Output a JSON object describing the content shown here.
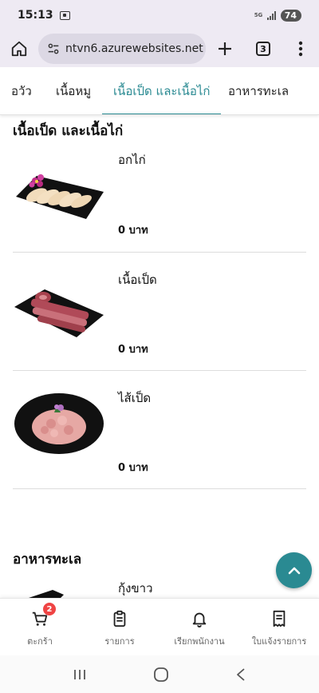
{
  "status_bar": {
    "time": "15:13",
    "network": "5G",
    "battery": "74"
  },
  "browser": {
    "url": "ntvn6.azurewebsites.net",
    "tab_count": "3"
  },
  "category_tabs": [
    {
      "label": "อวัว"
    },
    {
      "label": "เนื้อหมู"
    },
    {
      "label": "เนื้อเป็ด และเนื้อไก่"
    },
    {
      "label": "อาหารทะเล"
    }
  ],
  "sections": [
    {
      "title": "เนื้อเป็ด และเนื้อไก่",
      "products": [
        {
          "name": "อกไก่",
          "price": "0 บาท"
        },
        {
          "name": "เนื้อเป็ด",
          "price": "0 บาท"
        },
        {
          "name": "ไส้เป็ด",
          "price": "0 บาท"
        }
      ]
    },
    {
      "title": "อาหารทะเล",
      "products": [
        {
          "name": "กุ้งขาว"
        }
      ]
    }
  ],
  "bottom_nav": {
    "cart": {
      "label": "ตะกร้า",
      "badge": "2"
    },
    "orders": {
      "label": "รายการ"
    },
    "call_staff": {
      "label": "เรียกพนักงาน"
    },
    "bill": {
      "label": "ใบแจ้งรายการ"
    }
  },
  "colors": {
    "accent": "#2a8a92",
    "badge": "#ef4444"
  }
}
